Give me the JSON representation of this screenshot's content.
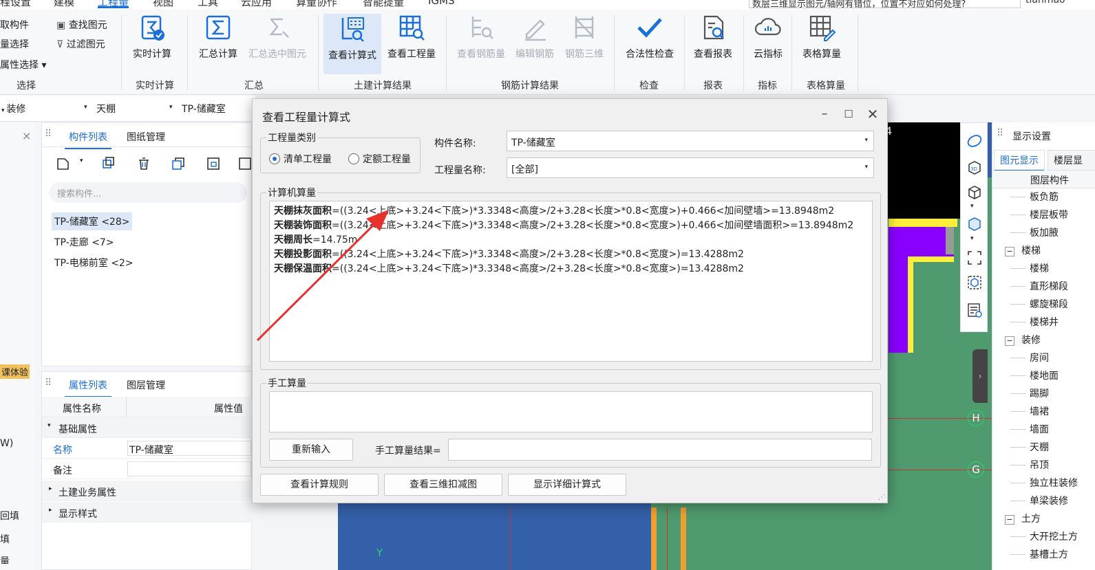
{
  "menu": {
    "items": [
      "程设置",
      "建模",
      "工程量",
      "视图",
      "工具",
      "云应用",
      "算量协作",
      "智能提量",
      "IGMS"
    ],
    "active_index": 2,
    "search_text": "数层三维显示图元/轴网有错位，位置不对应如何处理?",
    "user": "tianmao"
  },
  "ribbon": {
    "select_group": {
      "items": [
        "取构件",
        "查找图元",
        "量选择",
        "过滤图元",
        "属性选择"
      ],
      "group_label": "选择"
    },
    "buttons": [
      {
        "label": "实时计算",
        "icon": "realtime-calc-icon",
        "disabled": false
      },
      {
        "label": "汇总计算",
        "icon": "sum-calc-icon",
        "disabled": false
      },
      {
        "label": "汇总选中图元",
        "icon": "sum-selected-icon",
        "disabled": true
      },
      {
        "label": "查看计算式",
        "icon": "view-formula-icon",
        "disabled": false,
        "selected": true
      },
      {
        "label": "查看工程量",
        "icon": "view-quantity-icon",
        "disabled": false
      },
      {
        "label": "查看钢筋量",
        "icon": "view-rebar-icon",
        "disabled": true
      },
      {
        "label": "编辑钢筋",
        "icon": "edit-rebar-icon",
        "disabled": true
      },
      {
        "label": "钢筋三维",
        "icon": "rebar-3d-icon",
        "disabled": true
      },
      {
        "label": "合法性检查",
        "icon": "check-icon",
        "disabled": false
      },
      {
        "label": "查看报表",
        "icon": "report-icon",
        "disabled": false
      },
      {
        "label": "云指标",
        "icon": "cloud-index-icon",
        "disabled": false
      },
      {
        "label": "表格算量",
        "icon": "table-calc-icon",
        "disabled": false
      }
    ],
    "groups": [
      "实时计算",
      "汇总",
      "土建计算结果",
      "钢筋计算结果",
      "检查",
      "报表",
      "指标",
      "表格算量"
    ]
  },
  "selector_bar": {
    "level1": "装修",
    "level2": "天棚",
    "level3": "TP-储藏室"
  },
  "component_panel": {
    "tabs": [
      "构件列表",
      "图纸管理"
    ],
    "search_placeholder": "搜索构件...",
    "items": [
      "TP-储藏室 <28>",
      "TP-走廊 <7>",
      "TP-电梯前室 <2>"
    ],
    "selected_index": 0
  },
  "property_panel": {
    "tabs": [
      "属性列表",
      "图层管理"
    ],
    "col_name": "属性名称",
    "col_value": "属性值",
    "section_basic": "基础属性",
    "rows": [
      {
        "name": "名称",
        "value": "TP-储藏室"
      },
      {
        "name": "备注",
        "value": ""
      }
    ],
    "section_civil": "土建业务属性",
    "section_display": "显示样式"
  },
  "left_strip": {
    "badge": "课体验",
    "items": [
      "W)",
      "回填",
      "填",
      "量"
    ]
  },
  "dialog": {
    "title": "查看工程量计算式",
    "qty_category_legend": "工程量类别",
    "radio_bill": "清单工程量",
    "radio_quota": "定额工程量",
    "component_name_label": "构件名称:",
    "component_name_value": "TP-储藏室",
    "qty_name_label": "工程量名称:",
    "qty_name_value": "[全部]",
    "computer_calc_legend": "计算机算量",
    "formulas": [
      {
        "name": "天棚抹灰面积",
        "expr": "=((3.24<上底>+3.24<下底>)*3.3348<高度>/2+3.28<长度>*0.8<宽度>)+0.466<加间壁墙>=13.8948m2"
      },
      {
        "name": "天棚装饰面积",
        "expr": "=((3.24<上底>+3.24<下底>)*3.3348<高度>/2+3.28<长度>*0.8<宽度>)+0.466<加间壁墙面积>=13.8948m2"
      },
      {
        "name": "天棚周长",
        "expr": "=14.75m"
      },
      {
        "name": "天棚投影面积",
        "expr": "=((3.24<上底>+3.24<下底>)*3.3348<高度>/2+3.28<长度>*0.8<宽度>)=13.4288m2"
      },
      {
        "name": "天棚保温面积",
        "expr": "=((3.24<上底>+3.24<下底>)*3.3348<高度>/2+3.28<长度>*0.8<宽度>)=13.4288m2"
      }
    ],
    "manual_legend": "手工算量",
    "reinput_button": "重新输入",
    "manual_result_label": "手工算量结果=",
    "btn_rules": "查看计算规则",
    "btn_3d": "查看三维扣减图",
    "btn_detail": "显示详细计算式"
  },
  "display_settings": {
    "title": "显示设置",
    "tabs": [
      "图元显示",
      "楼层显"
    ],
    "col": "图层构件",
    "tree": [
      {
        "label": "板负筋",
        "level": 1
      },
      {
        "label": "楼层板带",
        "level": 1
      },
      {
        "label": "板加腋",
        "level": 1
      },
      {
        "label": "楼梯",
        "level": 0,
        "toggle": "−"
      },
      {
        "label": "楼梯",
        "level": 1
      },
      {
        "label": "直形梯段",
        "level": 1
      },
      {
        "label": "螺旋梯段",
        "level": 1
      },
      {
        "label": "楼梯井",
        "level": 1
      },
      {
        "label": "装修",
        "level": 0,
        "toggle": "−"
      },
      {
        "label": "房间",
        "level": 1
      },
      {
        "label": "楼地面",
        "level": 1
      },
      {
        "label": "踢脚",
        "level": 1
      },
      {
        "label": "墙裙",
        "level": 1
      },
      {
        "label": "墙面",
        "level": 1
      },
      {
        "label": "天棚",
        "level": 1
      },
      {
        "label": "吊顶",
        "level": 1
      },
      {
        "label": "独立柱装修",
        "level": 1
      },
      {
        "label": "单梁装修",
        "level": 1
      },
      {
        "label": "土方",
        "level": 0,
        "toggle": "−"
      },
      {
        "label": "大开挖土方",
        "level": 1
      },
      {
        "label": "基槽土方",
        "level": 1
      }
    ]
  },
  "canvas": {
    "axis_labels": [
      "4",
      "H",
      "G"
    ],
    "y_axis": "Y"
  },
  "colors": {
    "accent": "#1a6fd8",
    "canvas_bg": "#2f5fa8",
    "green_floor": "#4f9a6e",
    "purple": "#8a00ff",
    "yellow": "#ffef3a",
    "arrow": "#e8312a"
  }
}
